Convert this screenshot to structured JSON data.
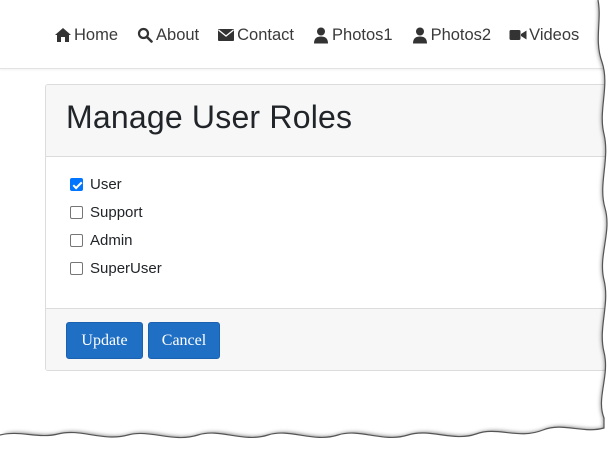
{
  "nav": {
    "items": [
      {
        "label": "Home",
        "icon": "home-icon"
      },
      {
        "label": "About",
        "icon": "search-icon"
      },
      {
        "label": "Contact",
        "icon": "envelope-icon"
      },
      {
        "label": "Photos1",
        "icon": "user-icon"
      },
      {
        "label": "Photos2",
        "icon": "user-icon"
      },
      {
        "label": "Videos",
        "icon": "video-camera-icon"
      },
      {
        "label": "",
        "icon": "list-icon"
      }
    ]
  },
  "card": {
    "title": "Manage User Roles",
    "roles": [
      {
        "label": "User",
        "checked": true
      },
      {
        "label": "Support",
        "checked": false
      },
      {
        "label": "Admin",
        "checked": false
      },
      {
        "label": "SuperUser",
        "checked": false
      }
    ],
    "buttons": {
      "update": "Update",
      "cancel": "Cancel"
    }
  },
  "colors": {
    "primary_button": "#1f6fc5",
    "checkbox_checked": "#0075ff",
    "header_bg": "#f7f7f7",
    "text": "#212529"
  }
}
